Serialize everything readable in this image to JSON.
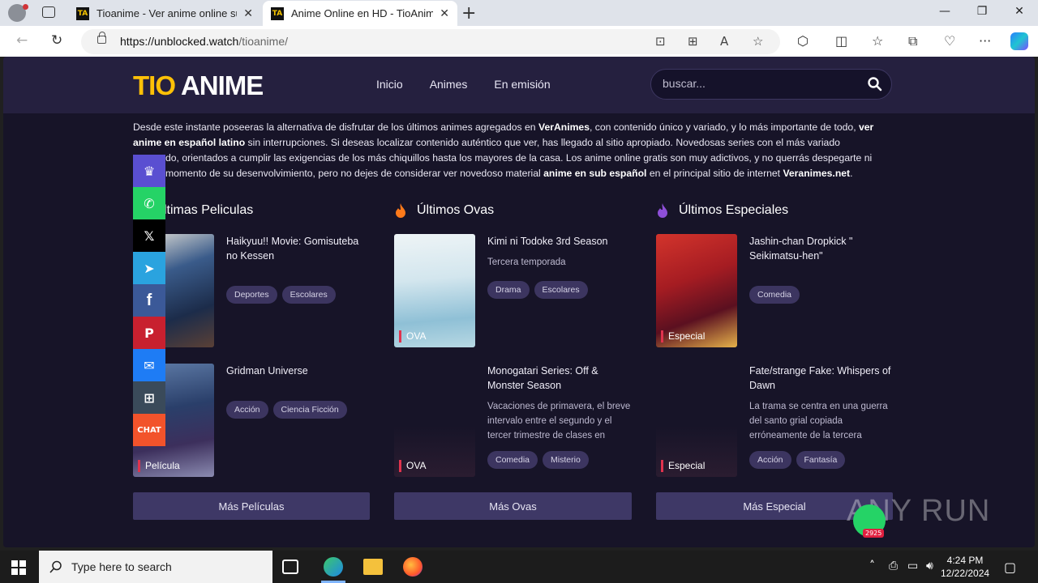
{
  "browser": {
    "tabs": [
      {
        "title": "Tioanime - Ver anime online sub",
        "favicon": "TA"
      },
      {
        "title": "Anime Online en HD - TioAnime",
        "favicon": "TA"
      }
    ],
    "url_domain": "https://unblocked.watch",
    "url_path": "/tioanime/"
  },
  "site": {
    "logo_part1": "TIO",
    "logo_part2": " ANIME",
    "menu": [
      "Inicio",
      "Animes",
      "En emisión"
    ],
    "search_placeholder": "buscar..."
  },
  "intro": {
    "p1": "Desde este instante poseeras la alternativa de disfrutar de los últimos animes agregados en ",
    "b1": "VerAnimes",
    "p2": ", con contenido único y variado, y lo más importante de todo, ",
    "b2": "ver anime en español latino",
    "p3": " sin interrupciones. Si deseas localizar contenido auténtico que ver, has llegado al sitio apropiado. Novedosas series con el más variado ",
    "p3b": "do, orientados a cumplir las exigencias de los más chiquillos hasta los mayores de la casa. Los anime online gratis son muy adictivos, y no querrás despegarte ni ",
    "p4": "momento de su desenvolvimiento, pero no dejes de considerar ver novedoso material ",
    "b3": "anime en sub español",
    "p5": " en el principal sitio de internet ",
    "b4": "Veranimes.net",
    "p6": "."
  },
  "sections": [
    {
      "title": "ltimas Peliculas",
      "more": "Más Películas",
      "items": [
        {
          "title": "Haikyuu!! Movie: Gomisuteba no Kessen",
          "desc": "",
          "type": "cula",
          "tags": [
            "Deportes",
            "Escolares"
          ]
        },
        {
          "title": "Gridman Universe",
          "desc": "",
          "type": "Película",
          "tags": [
            "Acción",
            "Ciencia Ficción"
          ]
        }
      ]
    },
    {
      "title": "Últimos Ovas",
      "more": "Más Ovas",
      "items": [
        {
          "title": "Kimi ni Todoke 3rd Season",
          "desc": "Tercera temporada",
          "type": "OVA",
          "tags": [
            "Drama",
            "Escolares"
          ]
        },
        {
          "title": "Monogatari Series: Off & Monster Season",
          "desc": "Vacaciones de primavera, el breve intervalo entre el segundo y el tercer trimestre de clases en",
          "type": "OVA",
          "tags": [
            "Comedia",
            "Misterio"
          ]
        }
      ]
    },
    {
      "title": "Últimos Especiales",
      "more": "Más Especial",
      "items": [
        {
          "title": "Jashin-chan Dropkick \" Seikimatsu-hen\"",
          "desc": "",
          "type": "Especial",
          "tags": [
            "Comedia"
          ]
        },
        {
          "title": "Fate/strange Fake: Whispers of Dawn",
          "desc": "La trama se centra en una guerra del santo grial copiada erróneamente de la tercera",
          "type": "Especial",
          "tags": [
            "Acción",
            "Fantasía"
          ]
        }
      ]
    }
  ],
  "social": {
    "chat_label": "CHAT"
  },
  "watermark": "ANY RUN",
  "chat_count": "2925",
  "taskbar": {
    "search_placeholder": "Type here to search",
    "time": "4:24 PM",
    "date": "12/22/2024"
  }
}
